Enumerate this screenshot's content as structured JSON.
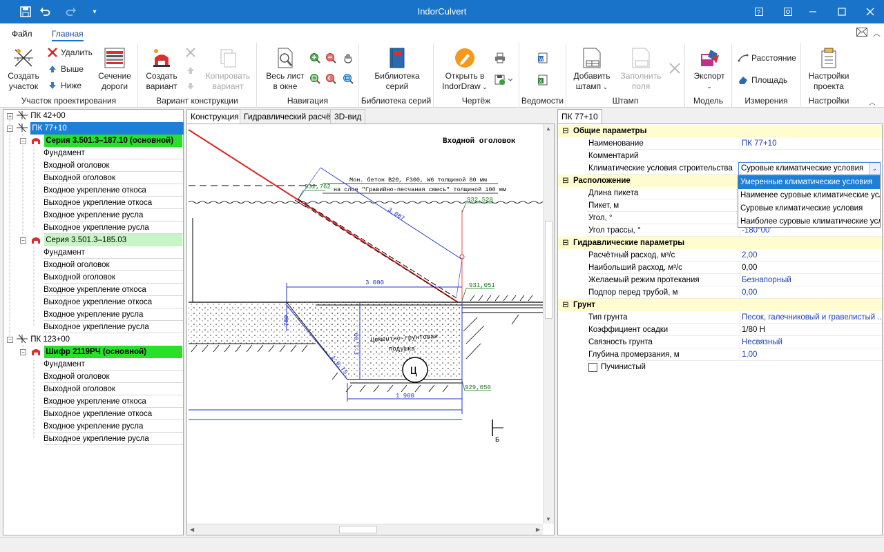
{
  "app": {
    "title": "IndorCulvert"
  },
  "quick_access": {
    "save_icon": "save-icon",
    "undo_icon": "undo-icon",
    "redo_icon": "redo-icon"
  },
  "menu": {
    "file": "Файл",
    "home": "Главная"
  },
  "ribbon": {
    "groups": [
      {
        "name": "Участок проектирования",
        "buttons": [
          "Создать\nучасток",
          "Удалить",
          "Выше",
          "Ниже",
          "Сечение\nдороги"
        ]
      },
      {
        "name": "Вариант конструкции",
        "buttons": [
          "Создать\nвариант",
          "Копировать\nвариант"
        ]
      },
      {
        "name": "Навигация",
        "buttons": [
          "Весь лист\nв окне"
        ]
      },
      {
        "name": "Библиотека серий",
        "buttons": [
          "Библиотека\nсерий"
        ]
      },
      {
        "name": "Чертёж",
        "buttons": [
          "Открыть в\nIndorDraw"
        ]
      },
      {
        "name": "Ведомости",
        "buttons": []
      },
      {
        "name": "Штамп",
        "buttons": [
          "Добавить\nштамп",
          "Заполнить\nполя"
        ]
      },
      {
        "name": "Модель",
        "buttons": [
          "Экспорт"
        ]
      },
      {
        "name": "Измерения",
        "buttons": [
          "Расстояние",
          "Площадь"
        ]
      },
      {
        "name": "Настройки",
        "buttons": [
          "Настройки\nпроекта"
        ]
      }
    ],
    "create_section": "Создать",
    "create_section2": "участок",
    "delete": "Удалить",
    "up": "Выше",
    "down": "Ниже",
    "road_section": "Сечение",
    "road_section2": "дороги",
    "create_variant": "Создать",
    "create_variant2": "вариант",
    "copy_variant": "Копировать",
    "copy_variant2": "вариант",
    "fit_sheet": "Весь лист",
    "fit_sheet2": "в окне",
    "library": "Библиотека",
    "library2": "серий",
    "open_in": "Открыть в",
    "open_in2": "IndorDraw",
    "add_stamp": "Добавить",
    "add_stamp2": "штамп",
    "fill_fields": "Заполнить",
    "fill_fields2": "поля",
    "export": "Экспорт",
    "distance": "Расстояние",
    "area": "Площадь",
    "project_settings": "Настройки",
    "project_settings2": "проекта"
  },
  "tree": {
    "nodes": [
      {
        "label": "ПК 42+00",
        "level": 0
      },
      {
        "label": "ПК 77+10",
        "level": 0,
        "selected": true
      },
      {
        "label": "Серия 3.501.3–187.10 (основной)",
        "level": 1,
        "style": "green"
      },
      {
        "label": "Фундамент",
        "level": 2
      },
      {
        "label": "Входной оголовок",
        "level": 2
      },
      {
        "label": "Выходной оголовок",
        "level": 2
      },
      {
        "label": "Входное укрепление откоса",
        "level": 2
      },
      {
        "label": "Выходное укрепление откоса",
        "level": 2
      },
      {
        "label": "Входное укрепление русла",
        "level": 2
      },
      {
        "label": "Выходное укрепление русла",
        "level": 2
      },
      {
        "label": "Серия 3.501.3–185.03",
        "level": 1,
        "style": "lightgreen"
      },
      {
        "label": "Фундамент",
        "level": 2
      },
      {
        "label": "Входной оголовок",
        "level": 2
      },
      {
        "label": "Выходной оголовок",
        "level": 2
      },
      {
        "label": "Входное укрепление откоса",
        "level": 2
      },
      {
        "label": "Выходное укрепление откоса",
        "level": 2
      },
      {
        "label": "Входное укрепление русла",
        "level": 2
      },
      {
        "label": "Выходное укрепление русла",
        "level": 2
      },
      {
        "label": "ПК 123+00",
        "level": 0
      },
      {
        "label": "Шифр 2119РЧ (основной)",
        "level": 1,
        "style": "green"
      },
      {
        "label": "Фундамент",
        "level": 2
      },
      {
        "label": "Входной оголовок",
        "level": 2
      },
      {
        "label": "Выходной оголовок",
        "level": 2
      },
      {
        "label": "Входное укрепление откоса",
        "level": 2
      },
      {
        "label": "Выходное укрепление откоса",
        "level": 2
      },
      {
        "label": "Входное укрепление русла",
        "level": 2
      },
      {
        "label": "Выходное укрепление русла",
        "level": 2
      }
    ]
  },
  "center_tabs": [
    "Конструкция",
    "Гидравлический расчёт",
    "3D-вид"
  ],
  "drawing": {
    "title": "Входной оголовок",
    "note1": "Мон. бетон В20, F300, W6 толщиной 80 мм",
    "note2": "на слое \"Гравийно-песчаная смесь\" толщиной 100 мм",
    "elev1": "932,762",
    "elev2": "932,528",
    "elev3": "931,051",
    "elev4": "929,650",
    "dim1": "3,087",
    "dim2": "3 000",
    "dim3": "1 900",
    "dim4": "700",
    "dim5": "1:1,00",
    "dim6": "1:0,75",
    "cushion1": "Цементно-грунтовая",
    "cushion2": "подушка",
    "mark": "Ц",
    "section": "Б"
  },
  "right_tab": "ПК 77+10",
  "properties": {
    "groups": [
      {
        "name": "Общие параметры",
        "rows": [
          {
            "name": "Наименование",
            "value": "ПК 77+10"
          },
          {
            "name": "Комментарий",
            "value": ""
          },
          {
            "name": "Климатические условия строительства",
            "value": "Суровые климатические условия"
          }
        ]
      },
      {
        "name": "Расположение",
        "rows": [
          {
            "name": "Длина пикета",
            "value": ""
          },
          {
            "name": "Пикет, м",
            "value": ""
          },
          {
            "name": "Угол, °",
            "value": ""
          },
          {
            "name": "Угол трассы, °",
            "value": "-180°00'"
          }
        ]
      },
      {
        "name": "Гидравлические параметры",
        "rows": [
          {
            "name": "Расчётный расход, м³/с",
            "value": "2,00"
          },
          {
            "name": "Наибольший расход, м³/с",
            "value": "0,00"
          },
          {
            "name": "Желаемый режим протекания",
            "value": "Безнапорный"
          },
          {
            "name": "Подпор перед трубой, м",
            "value": "0,00"
          }
        ]
      },
      {
        "name": "Грунт",
        "rows": [
          {
            "name": "Тип грунта",
            "value": "Песок, галечниковый и гравелистый ..."
          },
          {
            "name": "Коэффициент осадки",
            "value": "1/80 Н"
          },
          {
            "name": "Связность грунта",
            "value": "Несвязный"
          },
          {
            "name": "Глубина промерзания, м",
            "value": "1,00"
          },
          {
            "name": "Пучинистый",
            "value": ""
          }
        ]
      }
    ],
    "dropdown_options": [
      "Умеренные климатические условия",
      "Наименее суровые климатические условия",
      "Суровые климатические условия",
      "Наиболее суровые климатические условия"
    ],
    "dropdown_highlighted": "Умеренные климатические условия"
  },
  "colors": {
    "accent": "#1973c8",
    "selection": "#1e7fd8",
    "green": "#28e02a",
    "category": "#fffcd0"
  }
}
